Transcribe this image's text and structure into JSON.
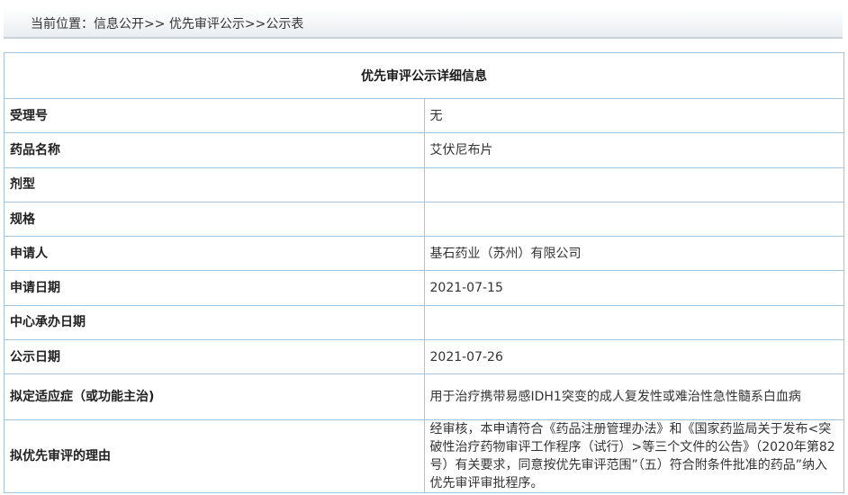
{
  "breadcrumb": {
    "text": "当前位置：信息公开>> 优先审评公示>>公示表"
  },
  "page_title": "优先审评公示详细信息",
  "fields": [
    {
      "label": "受理号",
      "value": "无"
    },
    {
      "label": "药品名称",
      "value": "艾伏尼布片"
    },
    {
      "label": "剂型",
      "value": ""
    },
    {
      "label": "规格",
      "value": ""
    },
    {
      "label": "申请人",
      "value": "基石药业（苏州）有限公司"
    },
    {
      "label": "申请日期",
      "value": "2021-07-15"
    },
    {
      "label": "中心承办日期",
      "value": ""
    },
    {
      "label": "公示日期",
      "value": "2021-07-26"
    },
    {
      "label": "拟定适应症（或功能主治)",
      "value": "用于治疗携带易感IDH1突变的成人复发性或难治性急性髓系白血病"
    },
    {
      "label": "拟优先审评的理由",
      "value": "经审核，本申请符合《药品注册管理办法》和《国家药监局关于发布<突破性治疗药物审评工作程序（试行）>等三个文件的公告》（2020年第82号）有关要求，同意按优先审评范围”（五）符合附条件批准的药品”纳入优先审评审批程序。"
    }
  ]
}
